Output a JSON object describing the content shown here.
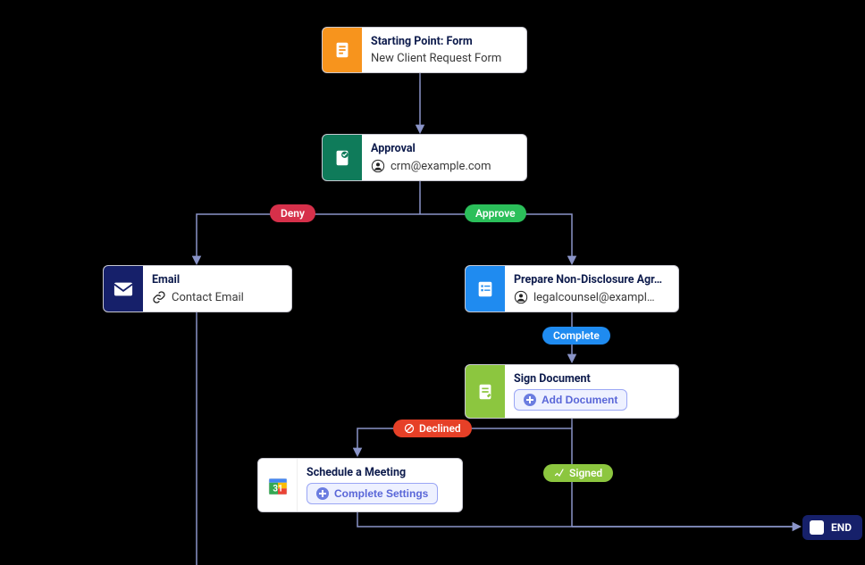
{
  "colors": {
    "orange": "#f7941d",
    "green_dark": "#0f7b5a",
    "navy": "#16206a",
    "blue": "#1f8bf0",
    "lime": "#8cc63f",
    "red": "#e64027",
    "green_bright": "#34c759",
    "cyan": "#2196d6",
    "lime_badge": "#8cc63f",
    "connector": "#8a94c8"
  },
  "nodes": {
    "start": {
      "title": "Starting Point: Form",
      "subtitle": "New Client Request Form"
    },
    "approval": {
      "title": "Approval",
      "subtitle": "crm@example.com"
    },
    "email": {
      "title": "Email",
      "subtitle": "Contact Email"
    },
    "prepare": {
      "title": "Prepare Non-Disclosure Agr…",
      "subtitle": "legalcounsel@exampl…"
    },
    "sign": {
      "title": "Sign Document",
      "button": "Add Document"
    },
    "schedule": {
      "title": "Schedule a Meeting",
      "button": "Complete Settings"
    },
    "end": {
      "label": "END"
    }
  },
  "badges": {
    "deny": "Deny",
    "approve": "Approve",
    "complete": "Complete",
    "declined": "Declined",
    "signed": "Signed"
  }
}
